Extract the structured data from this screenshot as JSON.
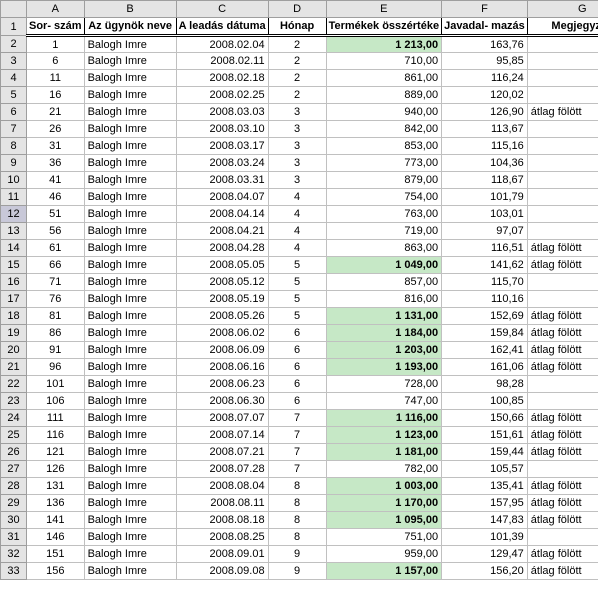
{
  "cols": [
    "A",
    "B",
    "C",
    "D",
    "E",
    "F",
    "G"
  ],
  "headers": {
    "A": "Sor-\nszám",
    "B": "Az ügynök\nneve",
    "C": "A leadás\ndátuma",
    "D": "Hónap",
    "E": "Termékek\nösszértéke",
    "F": "Javadal-\nmazás",
    "G": "Megjegyzés"
  },
  "selectedRow": 12,
  "rows": [
    {
      "n": 2,
      "A": "1",
      "B": "Balogh Imre",
      "C": "2008.02.04",
      "D": "2",
      "E": "1 213,00",
      "Eh": true,
      "F": "163,76",
      "G": ""
    },
    {
      "n": 3,
      "A": "6",
      "B": "Balogh Imre",
      "C": "2008.02.11",
      "D": "2",
      "E": "710,00",
      "Eh": false,
      "F": "95,85",
      "G": ""
    },
    {
      "n": 4,
      "A": "11",
      "B": "Balogh Imre",
      "C": "2008.02.18",
      "D": "2",
      "E": "861,00",
      "Eh": false,
      "F": "116,24",
      "G": ""
    },
    {
      "n": 5,
      "A": "16",
      "B": "Balogh Imre",
      "C": "2008.02.25",
      "D": "2",
      "E": "889,00",
      "Eh": false,
      "F": "120,02",
      "G": ""
    },
    {
      "n": 6,
      "A": "21",
      "B": "Balogh Imre",
      "C": "2008.03.03",
      "D": "3",
      "E": "940,00",
      "Eh": false,
      "F": "126,90",
      "G": "átlag fölött"
    },
    {
      "n": 7,
      "A": "26",
      "B": "Balogh Imre",
      "C": "2008.03.10",
      "D": "3",
      "E": "842,00",
      "Eh": false,
      "F": "113,67",
      "G": ""
    },
    {
      "n": 8,
      "A": "31",
      "B": "Balogh Imre",
      "C": "2008.03.17",
      "D": "3",
      "E": "853,00",
      "Eh": false,
      "F": "115,16",
      "G": ""
    },
    {
      "n": 9,
      "A": "36",
      "B": "Balogh Imre",
      "C": "2008.03.24",
      "D": "3",
      "E": "773,00",
      "Eh": false,
      "F": "104,36",
      "G": ""
    },
    {
      "n": 10,
      "A": "41",
      "B": "Balogh Imre",
      "C": "2008.03.31",
      "D": "3",
      "E": "879,00",
      "Eh": false,
      "F": "118,67",
      "G": ""
    },
    {
      "n": 11,
      "A": "46",
      "B": "Balogh Imre",
      "C": "2008.04.07",
      "D": "4",
      "E": "754,00",
      "Eh": false,
      "F": "101,79",
      "G": ""
    },
    {
      "n": 12,
      "A": "51",
      "B": "Balogh Imre",
      "C": "2008.04.14",
      "D": "4",
      "E": "763,00",
      "Eh": false,
      "F": "103,01",
      "G": ""
    },
    {
      "n": 13,
      "A": "56",
      "B": "Balogh Imre",
      "C": "2008.04.21",
      "D": "4",
      "E": "719,00",
      "Eh": false,
      "F": "97,07",
      "G": ""
    },
    {
      "n": 14,
      "A": "61",
      "B": "Balogh Imre",
      "C": "2008.04.28",
      "D": "4",
      "E": "863,00",
      "Eh": false,
      "F": "116,51",
      "G": "átlag fölött"
    },
    {
      "n": 15,
      "A": "66",
      "B": "Balogh Imre",
      "C": "2008.05.05",
      "D": "5",
      "E": "1 049,00",
      "Eh": true,
      "F": "141,62",
      "G": "átlag fölött"
    },
    {
      "n": 16,
      "A": "71",
      "B": "Balogh Imre",
      "C": "2008.05.12",
      "D": "5",
      "E": "857,00",
      "Eh": false,
      "F": "115,70",
      "G": ""
    },
    {
      "n": 17,
      "A": "76",
      "B": "Balogh Imre",
      "C": "2008.05.19",
      "D": "5",
      "E": "816,00",
      "Eh": false,
      "F": "110,16",
      "G": ""
    },
    {
      "n": 18,
      "A": "81",
      "B": "Balogh Imre",
      "C": "2008.05.26",
      "D": "5",
      "E": "1 131,00",
      "Eh": true,
      "F": "152,69",
      "G": "átlag fölött"
    },
    {
      "n": 19,
      "A": "86",
      "B": "Balogh Imre",
      "C": "2008.06.02",
      "D": "6",
      "E": "1 184,00",
      "Eh": true,
      "F": "159,84",
      "G": "átlag fölött"
    },
    {
      "n": 20,
      "A": "91",
      "B": "Balogh Imre",
      "C": "2008.06.09",
      "D": "6",
      "E": "1 203,00",
      "Eh": true,
      "F": "162,41",
      "G": "átlag fölött"
    },
    {
      "n": 21,
      "A": "96",
      "B": "Balogh Imre",
      "C": "2008.06.16",
      "D": "6",
      "E": "1 193,00",
      "Eh": true,
      "F": "161,06",
      "G": "átlag fölött"
    },
    {
      "n": 22,
      "A": "101",
      "B": "Balogh Imre",
      "C": "2008.06.23",
      "D": "6",
      "E": "728,00",
      "Eh": false,
      "F": "98,28",
      "G": ""
    },
    {
      "n": 23,
      "A": "106",
      "B": "Balogh Imre",
      "C": "2008.06.30",
      "D": "6",
      "E": "747,00",
      "Eh": false,
      "F": "100,85",
      "G": ""
    },
    {
      "n": 24,
      "A": "111",
      "B": "Balogh Imre",
      "C": "2008.07.07",
      "D": "7",
      "E": "1 116,00",
      "Eh": true,
      "F": "150,66",
      "G": "átlag fölött"
    },
    {
      "n": 25,
      "A": "116",
      "B": "Balogh Imre",
      "C": "2008.07.14",
      "D": "7",
      "E": "1 123,00",
      "Eh": true,
      "F": "151,61",
      "G": "átlag fölött"
    },
    {
      "n": 26,
      "A": "121",
      "B": "Balogh Imre",
      "C": "2008.07.21",
      "D": "7",
      "E": "1 181,00",
      "Eh": true,
      "F": "159,44",
      "G": "átlag fölött"
    },
    {
      "n": 27,
      "A": "126",
      "B": "Balogh Imre",
      "C": "2008.07.28",
      "D": "7",
      "E": "782,00",
      "Eh": false,
      "F": "105,57",
      "G": ""
    },
    {
      "n": 28,
      "A": "131",
      "B": "Balogh Imre",
      "C": "2008.08.04",
      "D": "8",
      "E": "1 003,00",
      "Eh": true,
      "F": "135,41",
      "G": "átlag fölött"
    },
    {
      "n": 29,
      "A": "136",
      "B": "Balogh Imre",
      "C": "2008.08.11",
      "D": "8",
      "E": "1 170,00",
      "Eh": true,
      "F": "157,95",
      "G": "átlag fölött"
    },
    {
      "n": 30,
      "A": "141",
      "B": "Balogh Imre",
      "C": "2008.08.18",
      "D": "8",
      "E": "1 095,00",
      "Eh": true,
      "F": "147,83",
      "G": "átlag fölött"
    },
    {
      "n": 31,
      "A": "146",
      "B": "Balogh Imre",
      "C": "2008.08.25",
      "D": "8",
      "E": "751,00",
      "Eh": false,
      "F": "101,39",
      "G": ""
    },
    {
      "n": 32,
      "A": "151",
      "B": "Balogh Imre",
      "C": "2008.09.01",
      "D": "9",
      "E": "959,00",
      "Eh": false,
      "F": "129,47",
      "G": "átlag fölött"
    },
    {
      "n": 33,
      "A": "156",
      "B": "Balogh Imre",
      "C": "2008.09.08",
      "D": "9",
      "E": "1 157,00",
      "Eh": true,
      "F": "156,20",
      "G": "átlag fölött"
    }
  ]
}
